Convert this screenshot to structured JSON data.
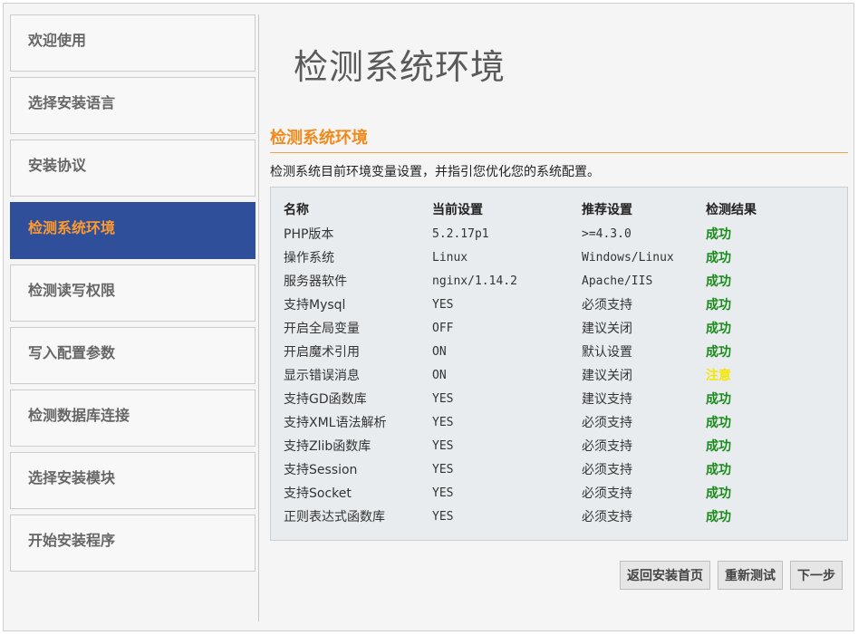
{
  "sidebar": {
    "items": [
      {
        "label": "欢迎使用"
      },
      {
        "label": "选择安装语言"
      },
      {
        "label": "安装协议"
      },
      {
        "label": "检测系统环境",
        "active": true
      },
      {
        "label": "检测读写权限"
      },
      {
        "label": "写入配置参数"
      },
      {
        "label": "检测数据库连接"
      },
      {
        "label": "选择安装模块"
      },
      {
        "label": "开始安装程序"
      }
    ]
  },
  "main": {
    "title": "检测系统环境",
    "section_title": "检测系统环境",
    "description": "检测系统目前环境变量设置，并指引您优化您的系统配置。"
  },
  "table": {
    "headers": [
      "名称",
      "当前设置",
      "推荐设置",
      "检测结果"
    ],
    "rows": [
      [
        "PHP版本",
        "5.2.17p1",
        ">=4.3.0",
        "成功"
      ],
      [
        "操作系统",
        "Linux",
        "Windows/Linux",
        "成功"
      ],
      [
        "服务器软件",
        "nginx/1.14.2",
        "Apache/IIS",
        "成功"
      ],
      [
        "支持Mysql",
        "YES",
        "必须支持",
        "成功"
      ],
      [
        "开启全局变量",
        "OFF",
        "建议关闭",
        "成功"
      ],
      [
        "开启魔术引用",
        "ON",
        "默认设置",
        "成功"
      ],
      [
        "显示错误消息",
        "ON",
        "建议关闭",
        "注意"
      ],
      [
        "支持GD函数库",
        "YES",
        "建议支持",
        "成功"
      ],
      [
        "支持XML语法解析",
        "YES",
        "必须支持",
        "成功"
      ],
      [
        "支持Zlib函数库",
        "YES",
        "必须支持",
        "成功"
      ],
      [
        "支持Session",
        "YES",
        "必须支持",
        "成功"
      ],
      [
        "支持Socket",
        "YES",
        "必须支持",
        "成功"
      ],
      [
        "正则表达式函数库",
        "YES",
        "必须支持",
        "成功"
      ]
    ]
  },
  "buttons": {
    "home": "返回安装首页",
    "retest": "重新测试",
    "next": "下一步"
  },
  "colors": {
    "active_step_bg": "#2f4f9a",
    "active_step_text": "#ff9a2c",
    "success": "#1a8a1a",
    "warning": "#f5e600",
    "section_title": "#f08a1c"
  }
}
